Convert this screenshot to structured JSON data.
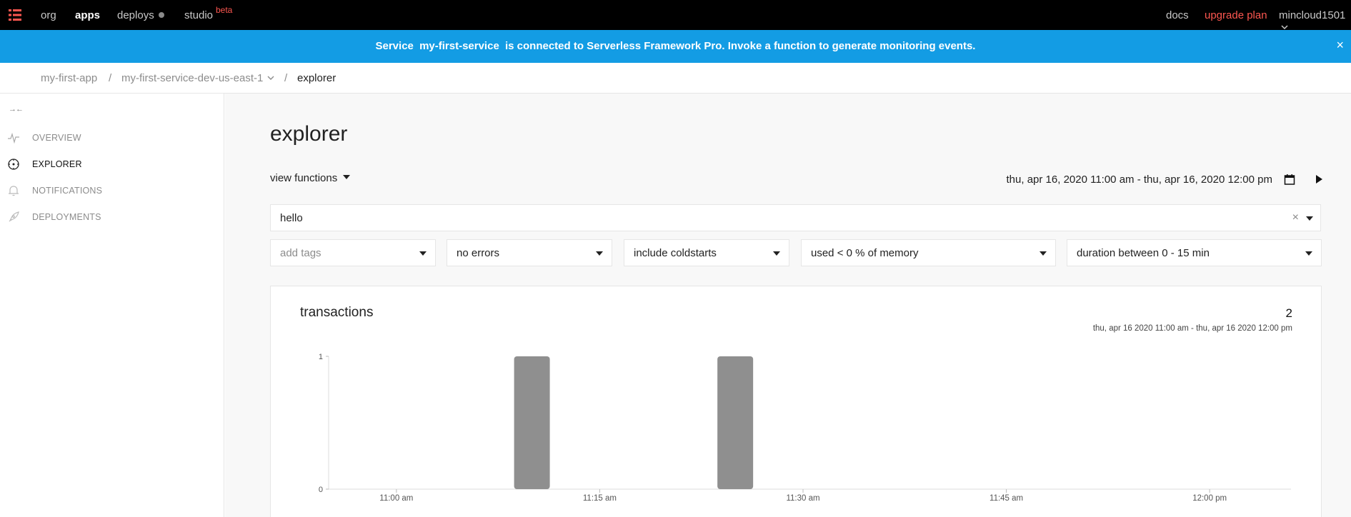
{
  "topnav": {
    "items": [
      {
        "label": "org"
      },
      {
        "label": "apps"
      },
      {
        "label": "deploys"
      },
      {
        "label": "studio"
      }
    ],
    "beta_badge": "beta",
    "docs": "docs",
    "upgrade": "upgrade plan",
    "account": "mincloud1501"
  },
  "banner": {
    "prefix": "Service",
    "service": "my-first-service",
    "suffix": "is connected to Serverless Framework Pro. Invoke a function to generate monitoring events.",
    "close": "×"
  },
  "breadcrumb": {
    "app": "my-first-app",
    "sep": "/",
    "service": "my-first-service-dev-us-east-1",
    "current": "explorer"
  },
  "sidebar": {
    "collapse": "→←",
    "items": [
      {
        "label": "OVERVIEW",
        "icon": "activity-icon"
      },
      {
        "label": "EXPLORER",
        "icon": "compass-icon"
      },
      {
        "label": "NOTIFICATIONS",
        "icon": "bell-icon"
      },
      {
        "label": "DEPLOYMENTS",
        "icon": "rocket-icon"
      }
    ]
  },
  "main": {
    "title": "explorer",
    "view_functions": "view functions",
    "date_range": "thu, apr 16, 2020 11:00 am - thu, apr 16, 2020 12:00 pm",
    "function_select": {
      "value": "hello",
      "clear": "×"
    },
    "filters": [
      {
        "value": "add tags",
        "placeholder": true
      },
      {
        "value": "no errors"
      },
      {
        "value": "include coldstarts"
      },
      {
        "value": "used < 0 % of memory"
      },
      {
        "value": "duration between 0 - 15 min"
      }
    ]
  },
  "card": {
    "title": "transactions",
    "count": "2",
    "range": "thu, apr 16 2020 11:00 am - thu, apr 16 2020 12:00 pm"
  },
  "colors": {
    "banner": "#139ce4",
    "accent": "#fd5750",
    "bar": "#8f8f8f"
  },
  "chart_data": {
    "type": "bar",
    "title": "transactions",
    "xlabel": "",
    "ylabel": "",
    "x_ticks": [
      "11:00 am",
      "11:15 am",
      "11:30 am",
      "11:45 am",
      "12:00 pm"
    ],
    "y_ticks": [
      "0",
      "1"
    ],
    "ylim": [
      0,
      1
    ],
    "xlim_minutes_from_11am": [
      -5,
      66
    ],
    "series": [
      {
        "points": [
          {
            "x": "11:10 am",
            "y": 1
          },
          {
            "x": "11:25 am",
            "y": 1
          }
        ]
      }
    ],
    "grid": false
  }
}
